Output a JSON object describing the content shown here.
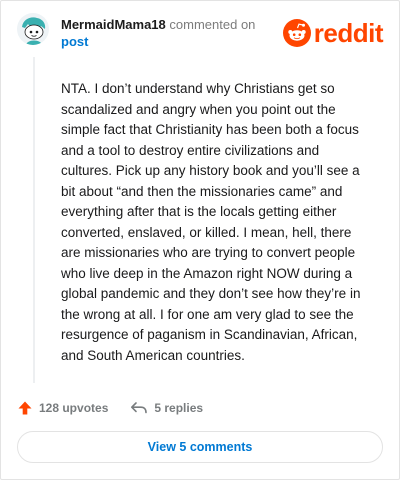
{
  "header": {
    "username": "MermaidMama18",
    "action_text": "commented on",
    "post_link": "post"
  },
  "brand": {
    "name": "reddit",
    "color": "#ff4500"
  },
  "comment": {
    "text": "NTA. I don’t understand why Christians get so scandalized and angry when you point out the simple fact that Christianity has been both a focus and a tool to destroy entire civilizations and cultures. Pick up any history book and you’ll see a bit about “and then the missionaries came” and everything after that is the locals getting either converted, enslaved, or killed. I mean, hell, there are missionaries who are trying to convert people who live deep in the Amazon right NOW during a global pandemic and they don’t see how they’re in the wrong at all. I for one am very glad to see the resurgence of paganism in Scandinavian, African, and South American countries."
  },
  "actions": {
    "upvotes": "128 upvotes",
    "replies": "5 replies"
  },
  "footer": {
    "view_button": "View 5 comments"
  },
  "colors": {
    "link": "#0079d3",
    "upvote_arrow": "#ff4500",
    "muted": "#787c7e"
  },
  "icons": {
    "avatar": "snoo-avatar-icon",
    "logo": "reddit-snoo-icon",
    "upvote": "upvote-arrow-icon",
    "reply": "reply-arrow-icon"
  }
}
